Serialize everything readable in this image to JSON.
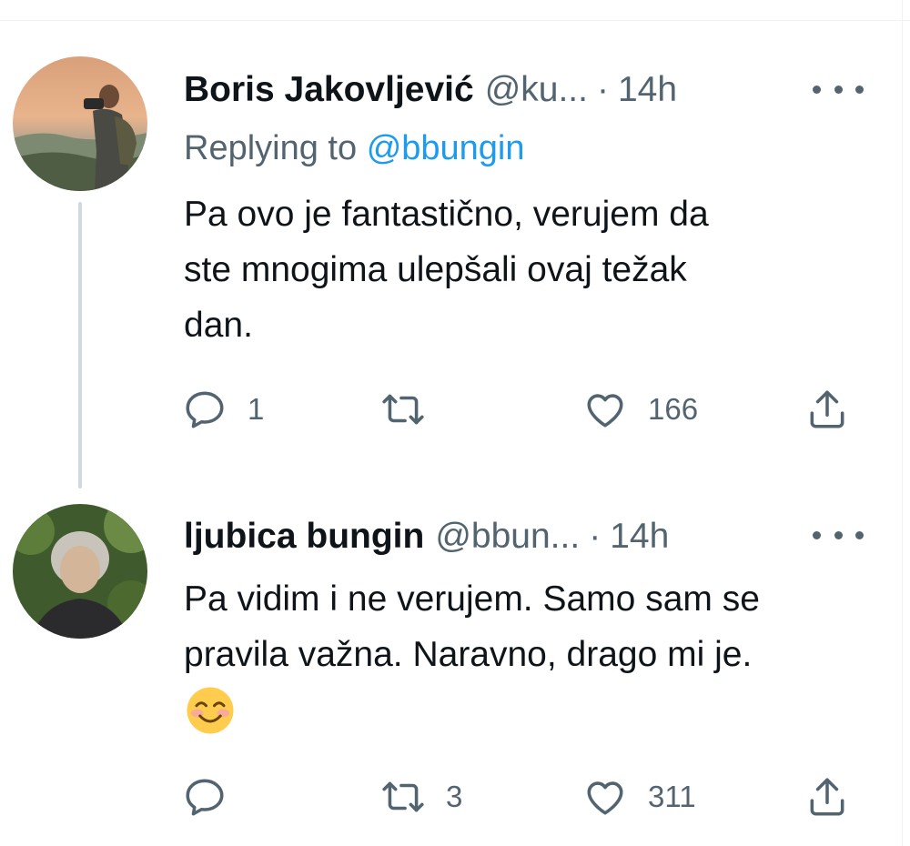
{
  "tweets": [
    {
      "author_name": "Boris Jakovljević",
      "handle": "@ku...",
      "separator": "·",
      "time": "14h",
      "replying_prefix": "Replying to",
      "replying_mention": "@bbungin",
      "text_lines": [
        "Pa ovo je fantastično, verujem da",
        "ste mnogima ulepšali ovaj težak",
        "dan."
      ],
      "actions": {
        "reply_count": "1",
        "retweet_count": "",
        "like_count": "166"
      }
    },
    {
      "author_name": "ljubica bungin",
      "handle": "@bbun...",
      "separator": "·",
      "time": "14h",
      "text_lines": [
        "Pa vidim i ne verujem. Samo sam se",
        "pravila važna. Naravno, drago mi je."
      ],
      "emoji": "smiling-face-with-smiling-eyes",
      "actions": {
        "reply_count": "",
        "retweet_count": "3",
        "like_count": "311"
      }
    }
  ],
  "colors": {
    "text": "#0f1419",
    "secondary": "#536471",
    "link": "#1d9bf0",
    "thread_line": "#cfd9de"
  },
  "icons": [
    "reply-icon",
    "retweet-icon",
    "like-icon",
    "share-icon",
    "more-icon"
  ]
}
